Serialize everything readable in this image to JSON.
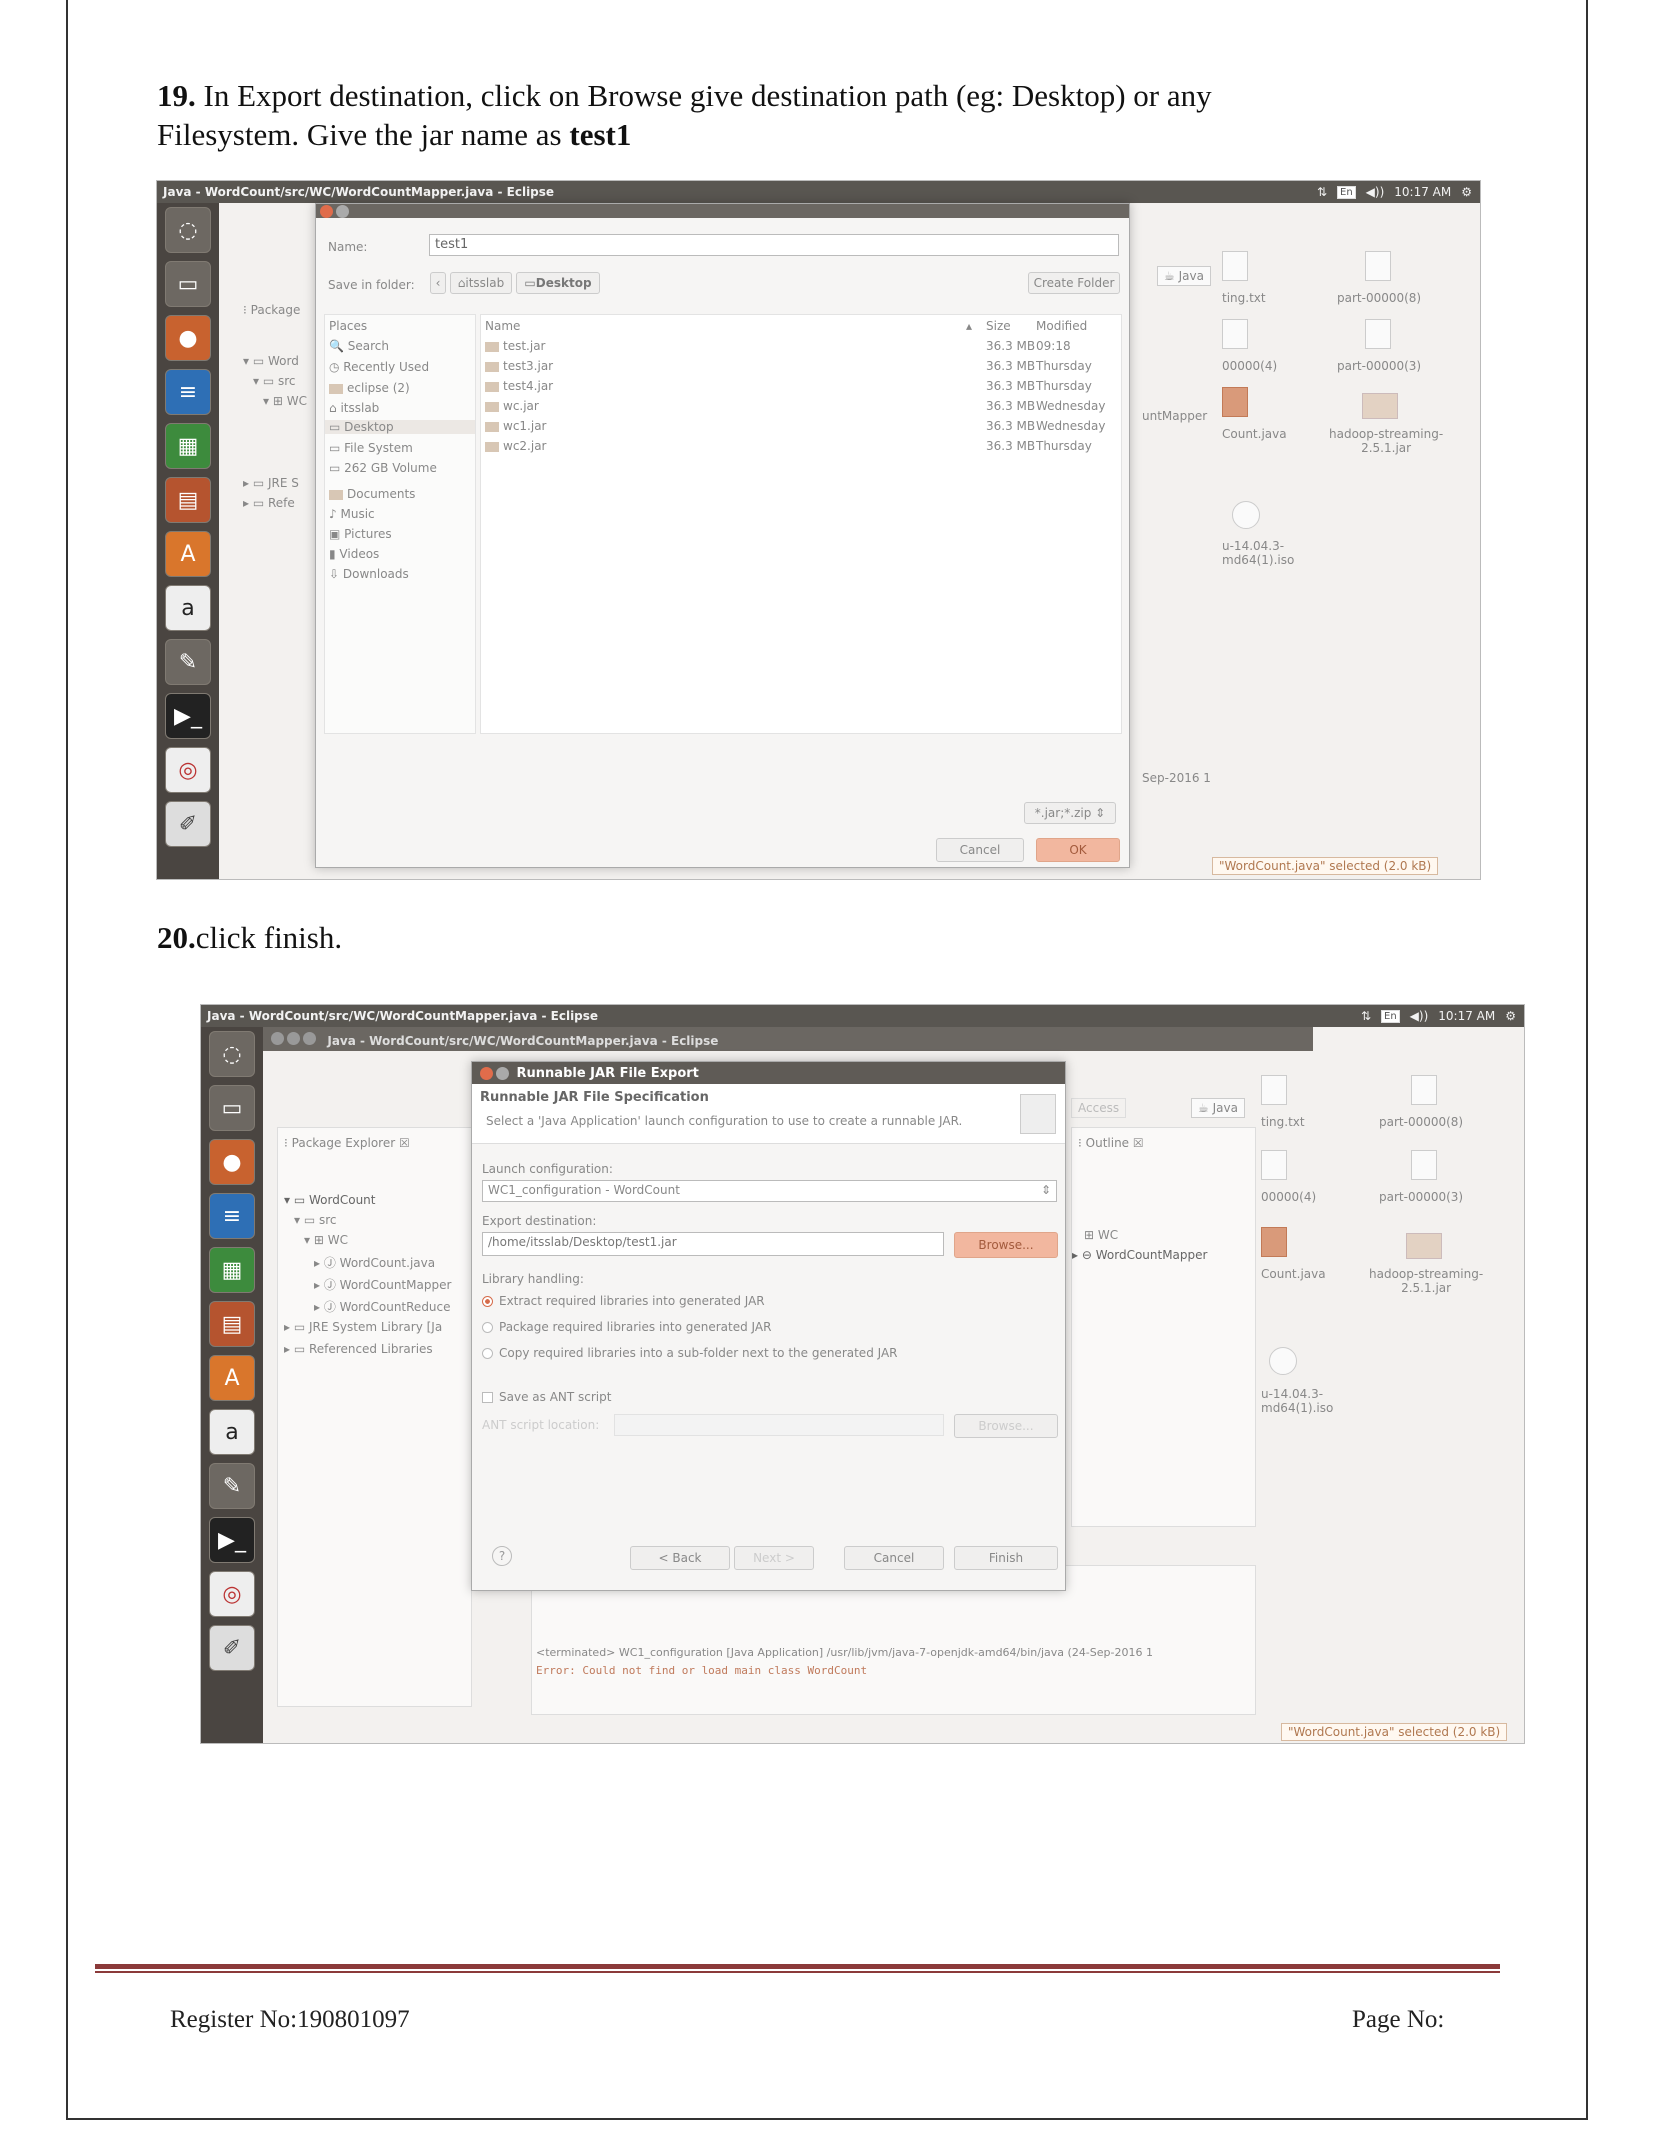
{
  "step19": {
    "number": "19.",
    "text": " In Export destination, click on Browse give destination path (eg: Desktop) or any",
    "line2_prefix": "Filesystem. Give the jar name as ",
    "line2_bold": "test1"
  },
  "step20": {
    "number": "20.",
    "text": "click finish."
  },
  "shot1": {
    "window_title": "Java - WordCount/src/WC/WordCountMapper.java - Eclipse",
    "time": "10:17 AM",
    "lang": "En",
    "dialog": {
      "name_label": "Name:",
      "name_value": "test1",
      "save_in_label": "Save in folder:",
      "crumb1": "itsslab",
      "crumb2": "Desktop",
      "create_folder": "Create Folder",
      "places_header": "Places",
      "name_header": "Name",
      "size_header": "Size",
      "modified_header": "Modified",
      "places": [
        "Search",
        "Recently Used",
        "eclipse (2)",
        "itsslab",
        "Desktop",
        "File System",
        "262 GB Volume",
        "Documents",
        "Music",
        "Pictures",
        "Videos",
        "Downloads"
      ],
      "files": [
        {
          "name": "test.jar",
          "size": "36.3 MB",
          "modified": "09:18"
        },
        {
          "name": "test3.jar",
          "size": "36.3 MB",
          "modified": "Thursday"
        },
        {
          "name": "test4.jar",
          "size": "36.3 MB",
          "modified": "Thursday"
        },
        {
          "name": "wc.jar",
          "size": "36.3 MB",
          "modified": "Wednesday"
        },
        {
          "name": "wc1.jar",
          "size": "36.3 MB",
          "modified": "Wednesday"
        },
        {
          "name": "wc2.jar",
          "size": "36.3 MB",
          "modified": "Thursday"
        }
      ],
      "filter": "*.jar;*.zip",
      "cancel": "Cancel",
      "ok": "OK"
    },
    "bg": {
      "package": "Package",
      "word": "Word",
      "src": "src",
      "wc": "WC",
      "jre": "JRE S",
      "refe": "Refe",
      "java_persp": "Java",
      "mapper": "untMapper",
      "date": "Sep-2016 1",
      "ting": "ting.txt",
      "part8": "part-00000(8)",
      "part4": "00000(4)",
      "part3": "part-00000(3)",
      "count_java": "Count.java",
      "hadoop": "hadoop-streaming-\n2.5.1.jar",
      "iso": "u-14.04.3-\nmd64(1).iso",
      "selected": "\"WordCount.java\" selected (2.0 kB)"
    }
  },
  "shot2": {
    "window_title": "Java - WordCount/src/WC/WordCountMapper.java - Eclipse",
    "inner_title": "Java - WordCount/src/WC/WordCountMapper.java - Eclipse",
    "time": "10:17 AM",
    "lang": "En",
    "dialog": {
      "title": "Runnable JAR File Export",
      "heading": "Runnable JAR File Specification",
      "desc": "Select a 'Java Application' launch configuration to use to create a runnable JAR.",
      "launch_label": "Launch configuration:",
      "launch_value": "WC1_configuration - WordCount",
      "export_label": "Export destination:",
      "export_value": "/home/itsslab/Desktop/test1.jar",
      "browse": "Browse...",
      "lib_label": "Library handling:",
      "opt1": "Extract required libraries into generated JAR",
      "opt2": "Package required libraries into generated JAR",
      "opt3": "Copy required libraries into a sub-folder next to the generated JAR",
      "save_ant": "Save as ANT script",
      "ant_loc": "ANT script location:",
      "browse2": "Browse...",
      "help": "?",
      "back": "< Back",
      "next": "Next >",
      "cancel": "Cancel",
      "finish": "Finish"
    },
    "bg": {
      "package_explorer": "Package Explorer",
      "wordcount": "WordCount",
      "src": "src",
      "wc": "WC",
      "f1": "WordCount.java",
      "f2": "WordCountMapper",
      "f3": "WordCountReduce",
      "jre": "JRE System Library [Ja",
      "ref": "Referenced Libraries",
      "java_persp": "Java",
      "access": "Access",
      "outline": "Outline",
      "out_wc": "WC",
      "out_mapper": "WordCountMapper",
      "console1": "<terminated> WC1_configuration [Java Application] /usr/lib/jvm/java-7-openjdk-amd64/bin/java (24-Sep-2016 1",
      "console2": "Error: Could not find or load main class WordCount",
      "ting": "ting.txt",
      "part8": "part-00000(8)",
      "part4": "00000(4)",
      "part3": "part-00000(3)",
      "count_java": "Count.java",
      "hadoop": "hadoop-streaming-\n2.5.1.jar",
      "iso": "u-14.04.3-\nmd64(1).iso",
      "selected": "\"WordCount.java\" selected (2.0 kB)"
    }
  },
  "footer": {
    "register": "Register  No:190801097",
    "page": "Page No:"
  },
  "colors": {
    "accent": "#d56b4a",
    "titlebar": "#595651",
    "footer_rule": "#8b3a3a"
  }
}
